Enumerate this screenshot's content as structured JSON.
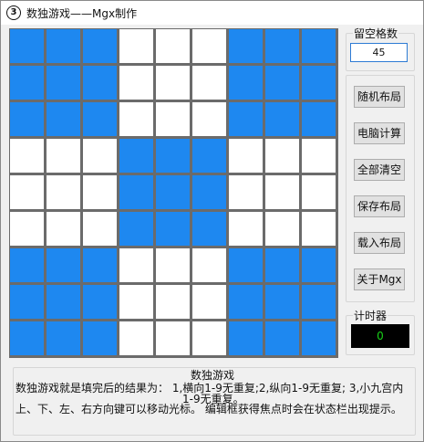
{
  "window": {
    "title": "数独游戏——Mgx制作",
    "icon_glyph": "3"
  },
  "board": {
    "blank_color": "#ffffff",
    "filled_color": "#1e88f0",
    "grid_color": "#6b6b6b",
    "rows": [
      [
        "B",
        "B",
        "B",
        "W",
        "W",
        "W",
        "B",
        "B",
        "B"
      ],
      [
        "B",
        "B",
        "B",
        "W",
        "W",
        "W",
        "B",
        "B",
        "B"
      ],
      [
        "B",
        "B",
        "B",
        "W",
        "W",
        "W",
        "B",
        "B",
        "B"
      ],
      [
        "W",
        "W",
        "W",
        "B",
        "B",
        "B",
        "W",
        "W",
        "W"
      ],
      [
        "W",
        "W",
        "W",
        "B",
        "B",
        "B",
        "W",
        "W",
        "W"
      ],
      [
        "W",
        "W",
        "W",
        "B",
        "B",
        "B",
        "W",
        "W",
        "W"
      ],
      [
        "B",
        "B",
        "B",
        "W",
        "W",
        "W",
        "B",
        "B",
        "B"
      ],
      [
        "B",
        "B",
        "B",
        "W",
        "W",
        "W",
        "B",
        "B",
        "B"
      ],
      [
        "B",
        "B",
        "B",
        "W",
        "W",
        "W",
        "B",
        "B",
        "B"
      ]
    ]
  },
  "blank_count": {
    "label": "留空格数",
    "value": "45"
  },
  "buttons": {
    "random_layout": "随机布局",
    "computer_solve": "电脑计算",
    "clear_all": "全部清空",
    "save_layout": "保存布局",
    "load_layout": "载入布局",
    "about": "关于Mgx"
  },
  "timer": {
    "label": "计时器",
    "value": "0"
  },
  "info": {
    "title": "数独游戏",
    "line1": "数独游戏就是填完后的结果为： 1,横向1-9无重复;2,纵向1-9无重复; 3,小九宫内",
    "line2": "1-9无重复。",
    "line3": "上、下、左、右方向键可以移动光标。 编辑框获得焦点时会在状态栏出现提示。"
  }
}
